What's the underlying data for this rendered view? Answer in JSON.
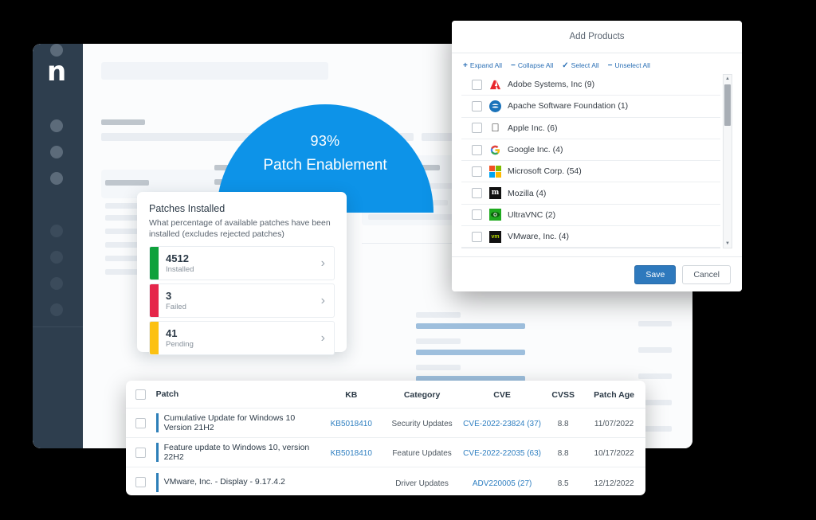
{
  "app": {
    "logo": "n",
    "sidebar_dots": 8
  },
  "gauge": {
    "percent_label": "93%",
    "title": "Patch Enablement",
    "value": 93,
    "remainder": 7,
    "primary_color": "#0d93e8",
    "secondary_color": "#03a0bb"
  },
  "patches_card": {
    "title": "Patches Installed",
    "subtitle": "What percentage of available patches have been installed (excludes rejected patches)",
    "rows": [
      {
        "count": "4512",
        "label": "Installed",
        "color": "#0fa13c",
        "chevron": "›"
      },
      {
        "count": "3",
        "label": "Failed",
        "color": "#e5264a",
        "chevron": "›"
      },
      {
        "count": "41",
        "label": "Pending",
        "color": "#fcc111",
        "chevron": "›"
      }
    ]
  },
  "patch_table": {
    "columns": [
      "Patch",
      "KB",
      "Category",
      "CVE",
      "CVSS",
      "Patch Age"
    ],
    "rows": [
      {
        "patch": "Cumulative Update for Windows 10 Version 21H2",
        "kb": "KB5018410",
        "category": "Security Updates",
        "cve": "CVE-2022-23824 (37)",
        "cvss": "8.8",
        "age": "11/07/2022"
      },
      {
        "patch": "Feature update to Windows 10, version 22H2",
        "kb": "KB5018410",
        "category": "Feature Updates",
        "cve": "CVE-2022-22035 (63)",
        "cvss": "8.8",
        "age": "10/17/2022"
      },
      {
        "patch": "VMware, Inc. - Display - 9.17.4.2",
        "kb": "",
        "category": "Driver Updates",
        "cve": "ADV220005 (27)",
        "cvss": "8.5",
        "age": "12/12/2022"
      }
    ]
  },
  "modal": {
    "title": "Add Products",
    "toolbar": [
      {
        "symbol": "+",
        "label": "Expand All"
      },
      {
        "symbol": "−",
        "label": "Collapse All"
      },
      {
        "symbol": "✓",
        "label": "Select All"
      },
      {
        "symbol": "−",
        "label": "Unselect All"
      }
    ],
    "vendors": [
      {
        "label": "Adobe Systems, Inc (9)",
        "icon": "adobe-icon"
      },
      {
        "label": "Apache Software Foundation (1)",
        "icon": "apache-icon"
      },
      {
        "label": "Apple Inc. (6)",
        "icon": "apple-icon"
      },
      {
        "label": "Google Inc. (4)",
        "icon": "google-icon"
      },
      {
        "label": "Microsoft Corp. (54)",
        "icon": "microsoft-icon"
      },
      {
        "label": "Mozilla (4)",
        "icon": "mozilla-icon"
      },
      {
        "label": "UltraVNC (2)",
        "icon": "ultravnc-icon"
      },
      {
        "label": "VMware, Inc. (4)",
        "icon": "vmware-icon"
      }
    ],
    "buttons": {
      "save": "Save",
      "cancel": "Cancel"
    }
  }
}
